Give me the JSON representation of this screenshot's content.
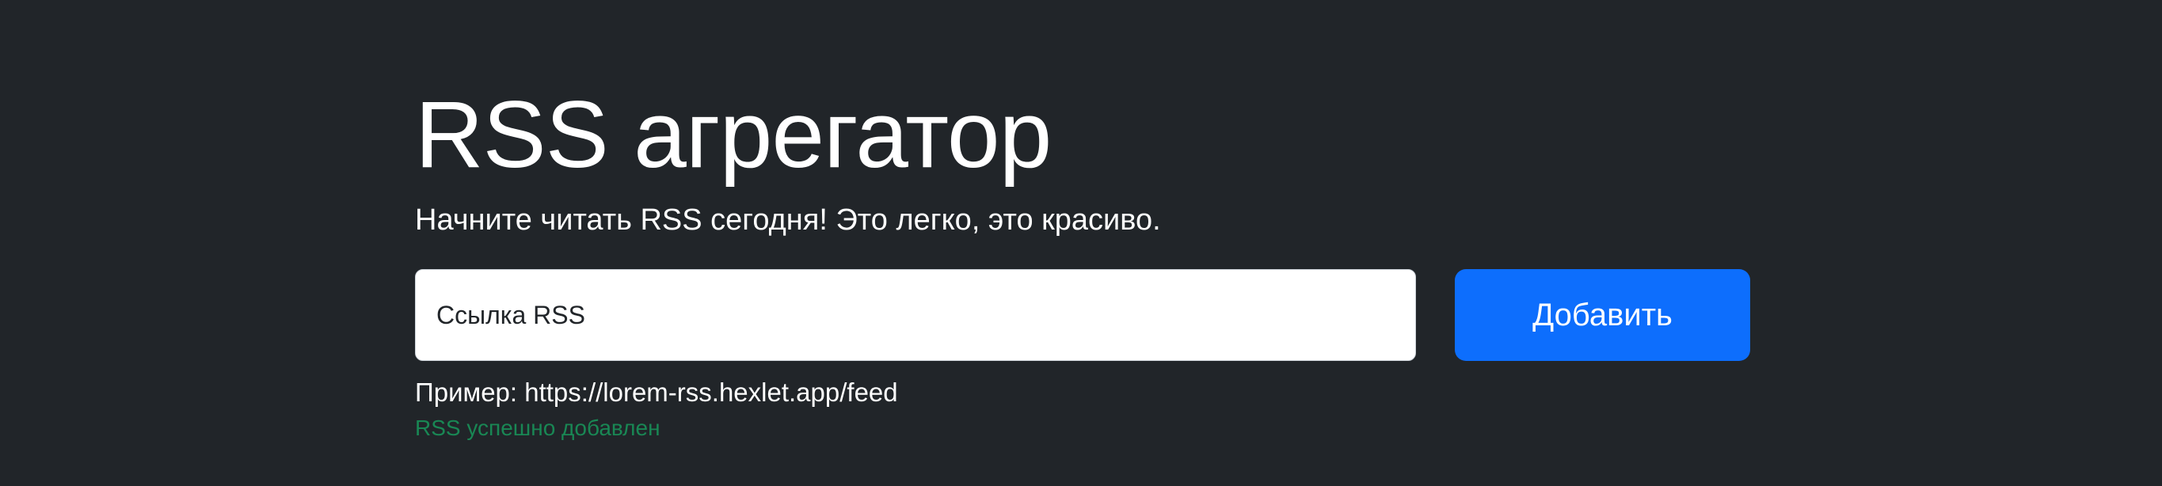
{
  "header": {
    "title": "RSS агрегатор",
    "lead": "Начните читать RSS сегодня! Это легко, это красиво."
  },
  "form": {
    "url_value": "",
    "url_placeholder": "Ссылка RSS",
    "submit_label": "Добавить"
  },
  "example": {
    "text": "Пример: https://lorem-rss.hexlet.app/feed"
  },
  "feedback": {
    "text": "RSS успешно добавлен",
    "status": "success"
  },
  "colors": {
    "background": "#212529",
    "primary": "#0d6efd",
    "success": "#198754",
    "text": "#ffffff"
  }
}
